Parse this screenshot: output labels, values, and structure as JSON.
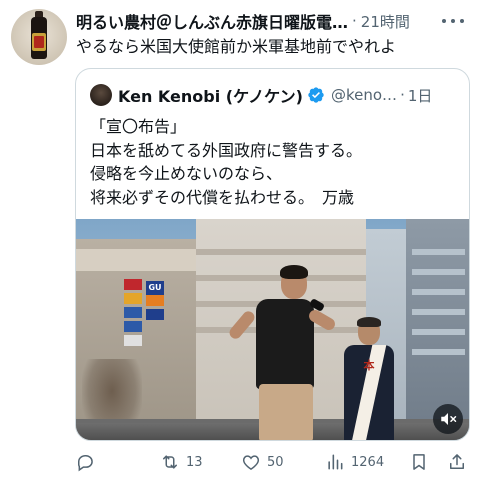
{
  "post": {
    "display_name": "明るい農村＠しんぶん赤旗日曜版電…",
    "time_separator": "·",
    "timestamp": "21時間",
    "text": "やるなら米国大使館前か米軍基地前でやれよ"
  },
  "quoted_post": {
    "display_name": "Ken Kenobi (ケノケン)",
    "handle": "@keno…",
    "time_separator": "·",
    "timestamp": "1日",
    "lines": [
      "「宣〇布告」",
      "日本を舐めてる外国政府に警告する。",
      "侵略を今止めないのなら、",
      "将来必ずその代償を払わせる。　万歳"
    ],
    "media_signs": {
      "gu": "GU",
      "sash_mark": "本"
    }
  },
  "actions": {
    "reply_count": "",
    "repost_count": "13",
    "like_count": "50",
    "views_count": "1264"
  },
  "icons": {
    "more": "more-icon",
    "verified": "verified-icon",
    "mute": "mute-icon",
    "reply": "reply-icon",
    "repost": "repost-icon",
    "like": "like-icon",
    "views": "views-icon",
    "bookmark": "bookmark-icon",
    "share": "share-icon"
  },
  "colors": {
    "text": "#0f1419",
    "secondary": "#536471",
    "verified": "#1d9bf0",
    "border": "#cfd9de"
  }
}
